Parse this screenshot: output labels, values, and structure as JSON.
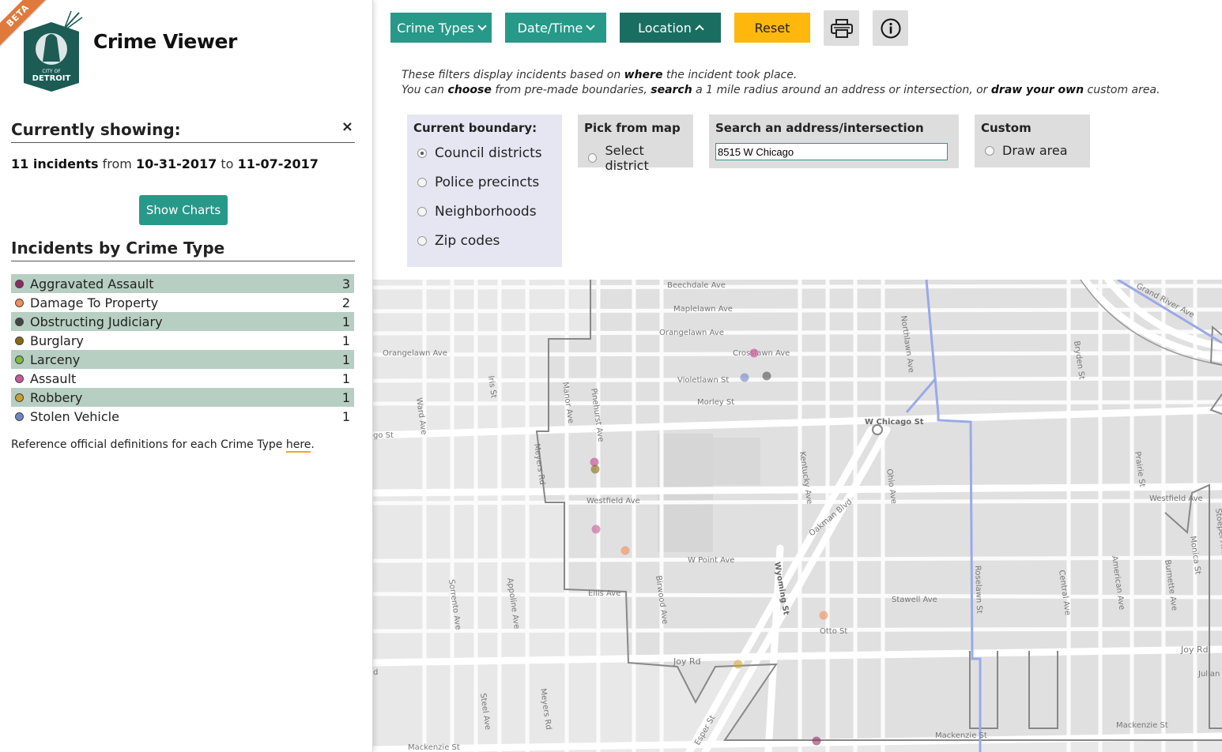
{
  "app": {
    "badge": "BETA",
    "title": "Crime Viewer",
    "logo_text_top": "CITY OF",
    "logo_text": "DETROIT"
  },
  "summary": {
    "heading": "Currently showing:",
    "close": "×",
    "count": "11 incidents",
    "from_word": "from",
    "start": "10-31-2017",
    "to_word": "to",
    "end": "11-07-2017",
    "charts_button": "Show Charts"
  },
  "crime_types": {
    "heading": "Incidents by Crime Type",
    "items": [
      {
        "label": "Aggravated Assault",
        "count": "3",
        "color": "#8e2b5e"
      },
      {
        "label": "Damage To Property",
        "count": "2",
        "color": "#f08e5c"
      },
      {
        "label": "Obstructing Judiciary",
        "count": "1",
        "color": "#444444"
      },
      {
        "label": "Burglary",
        "count": "1",
        "color": "#8a6a0c"
      },
      {
        "label": "Larceny",
        "count": "1",
        "color": "#7fba3e"
      },
      {
        "label": "Assault",
        "count": "1",
        "color": "#c85a9a"
      },
      {
        "label": "Robbery",
        "count": "1",
        "color": "#c9a030"
      },
      {
        "label": "Stolen Vehicle",
        "count": "1",
        "color": "#6f85c4"
      }
    ],
    "ref_text": "Reference official definitions for each Crime Type",
    "ref_link": "here",
    "ref_end": "."
  },
  "toolbar": {
    "crime_types": "Crime Types",
    "date_time": "Date/Time",
    "location": "Location",
    "reset": "Reset",
    "print_icon": "printer-icon",
    "info_icon": "info-icon"
  },
  "location": {
    "line1_a": "These filters display incidents based on",
    "line1_b": "where",
    "line1_c": "the incident took place.",
    "line2_a": "You can",
    "line2_b": "choose",
    "line2_c": "from pre-made boundaries,",
    "line2_d": "search",
    "line2_e": "a 1 mile radius around an address or intersection, or",
    "line2_f": "draw your own",
    "line2_g": "custom area.",
    "boundary_title": "Current boundary:",
    "boundaries": [
      "Council districts",
      "Police precincts",
      "Neighborhoods",
      "Zip codes"
    ],
    "pick_title": "Pick from map",
    "pick_option": "Select district",
    "search_title": "Search an address/intersection",
    "search_value": "8515 W Chicago",
    "custom_title": "Custom",
    "custom_option": "Draw area"
  },
  "map": {
    "streets": [
      "Beechdale Ave",
      "Maplelawn Ave",
      "Orangelawn Ave",
      "Orangelawn Ave",
      "Crosslawn Ave",
      "Violetlawn St",
      "Morley St",
      "W Chicago St",
      "Westfield Ave",
      "Westfield Ave",
      "W Point Ave",
      "Ellis Ave",
      "Stawell Ave",
      "Otto St",
      "Joy Rd",
      "Joy Rd",
      "Mackenzie St",
      "Mackenzie St",
      "Mackenzie St",
      "Oakman Blvd",
      "Wyoming St",
      "Grand River Ave",
      "Northlawn Ave",
      "Bryden St",
      "Kentucky Ave",
      "Ohio Ave",
      "Prairie St",
      "Manor Ave",
      "Pinehurst Ave",
      "Meyers Rd",
      "Meyers Rd",
      "Iris St",
      "Ward Ave",
      "Sorrento Ave",
      "Appoline Ave",
      "Birwood Ave",
      "Roselawn St",
      "Central Ave",
      "American Ave",
      "Burnette Ave",
      "Monica St",
      "Steel Ave",
      "Esper St",
      "Julian",
      "Stoepel Ave",
      "go St",
      "d"
    ]
  }
}
